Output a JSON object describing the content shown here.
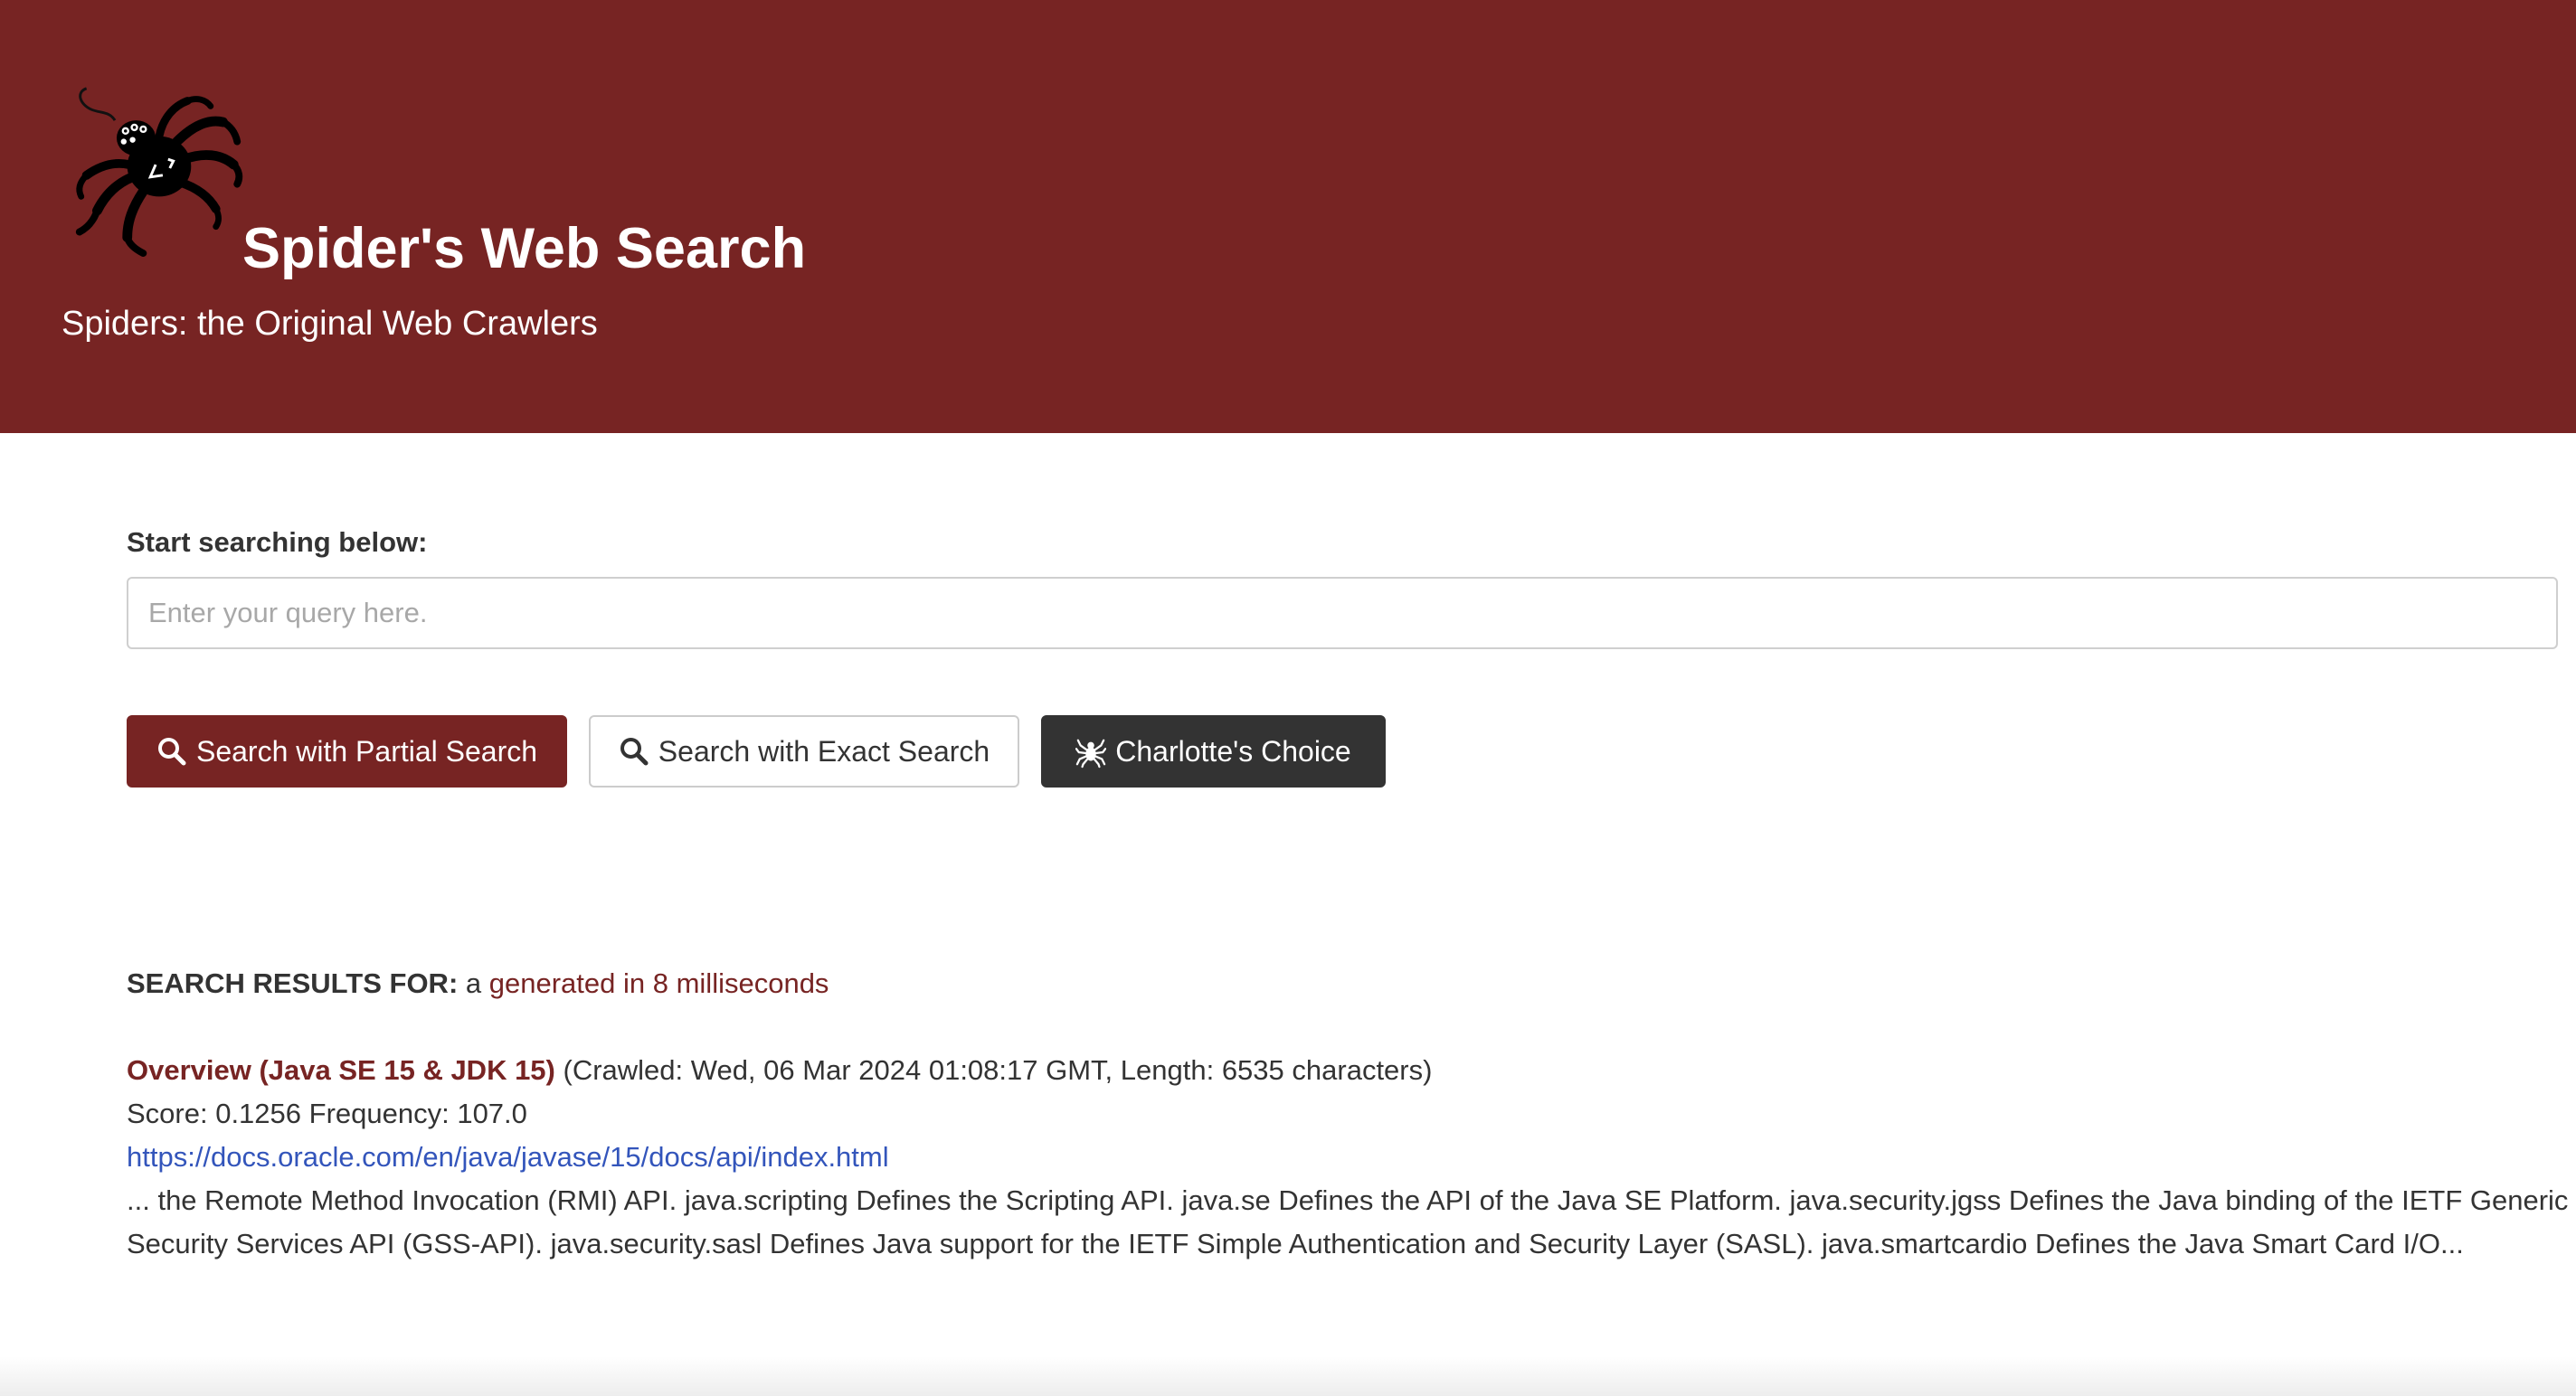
{
  "header": {
    "title": "Spider's Web Search",
    "tagline": "Spiders: the Original Web Crawlers",
    "logo_icon": "spider-logo-icon",
    "background_color": "#772423"
  },
  "search": {
    "label": "Start searching below:",
    "placeholder": "Enter your query here.",
    "value": "",
    "partial_button_label": "Search with Partial Search",
    "exact_button_label": "Search with Exact Search",
    "charlotte_button_label": "Charlotte's Choice",
    "partial_button_icon": "search-icon",
    "exact_button_icon": "search-icon",
    "charlotte_button_icon": "spider-icon"
  },
  "results": {
    "header_label": "SEARCH RESULTS FOR:",
    "query": "a",
    "timing": "generated in 8 milliseconds",
    "items": [
      {
        "title": "Overview (Java SE 15 & JDK 15)",
        "meta": "(Crawled: Wed, 06 Mar 2024 01:08:17 GMT, Length: 6535 characters)",
        "score_line": "Score: 0.1256 Frequency: 107.0",
        "url": "https://docs.oracle.com/en/java/javase/15/docs/api/index.html",
        "snippet": "... the Remote Method Invocation (RMI) API. java.scripting Defines the Scripting API. java.se Defines the API of the Java SE Platform. java.security.jgss Defines the Java binding of the IETF Generic Security Services API (GSS-API). java.security.sasl Defines Java support for the IETF Simple Authentication and Security Layer (SASL). java.smartcardio Defines the Java Smart Card I/O..."
      }
    ]
  },
  "colors": {
    "accent": "#772423",
    "link": "#3355bb",
    "dark_button": "#333333"
  }
}
